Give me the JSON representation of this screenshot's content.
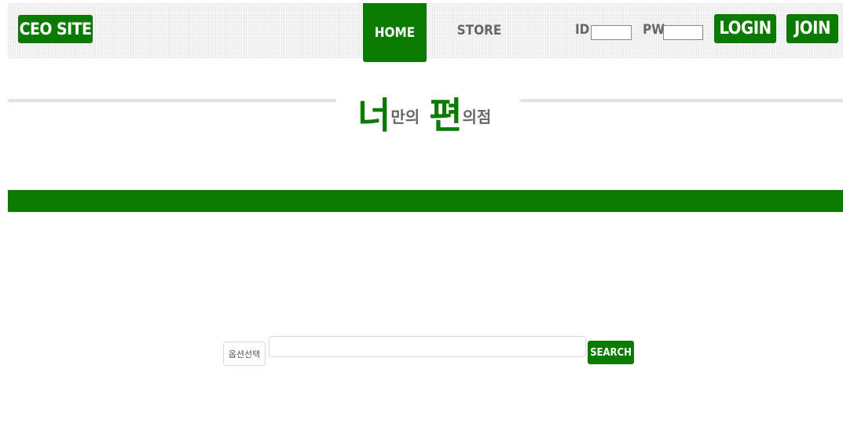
{
  "header": {
    "ceo_label": "CEO SITE",
    "nav": {
      "home": "HOME",
      "store": "STORE"
    },
    "id_label": "ID:",
    "pw_label": "PW:",
    "id_value": "",
    "pw_value": "",
    "login_label": "LOGIN",
    "join_label": "JOIN"
  },
  "logo": {
    "char1": "너",
    "text1": "만의",
    "char2": "편",
    "text2": "의점"
  },
  "search": {
    "select_label": "옵션선택",
    "input_value": "",
    "button_label": "SEARCH"
  },
  "colors": {
    "accent": "#0a7a00",
    "nav_text": "#666666",
    "divider": "#e2e2e2"
  }
}
